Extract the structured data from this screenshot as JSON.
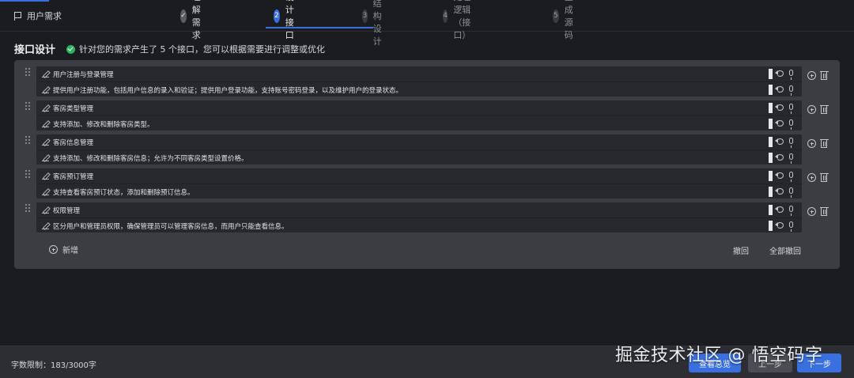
{
  "header": {
    "crumb_label": "用户需求"
  },
  "steps": [
    {
      "num": "✓",
      "label": "理解需求",
      "state": "done"
    },
    {
      "num": "2",
      "label": "设计接口",
      "state": "active"
    },
    {
      "num": "3",
      "label": "表结构设计",
      "state": "pending"
    },
    {
      "num": "4",
      "label": "处理逻辑（接口）",
      "state": "pending"
    },
    {
      "num": "5",
      "label": "生成源码",
      "state": "pending"
    }
  ],
  "section": {
    "title": "接口设计",
    "notice": "针对您的需求产生了 5 个接口，您可以根据需要进行调整或优化"
  },
  "interfaces": [
    {
      "name": "用户注册与登录管理",
      "description": "提供用户注册功能，包括用户信息的录入和验证；提供用户登录功能，支持账号密码登录，以及维护用户的登录状态。"
    },
    {
      "name": "客房类型管理",
      "description": "支持添加、修改和删除客房类型。"
    },
    {
      "name": "客房信息管理",
      "description": "支持添加、修改和删除客房信息；允许为不同客房类型设置价格。"
    },
    {
      "name": "客房预订管理",
      "description": "支持查看客房预订状态，添加和删除预订信息。"
    },
    {
      "name": "权限管理",
      "description": "区分用户和管理员权限，确保管理员可以管理客房信息，而用户只能查看信息。"
    }
  ],
  "actions": {
    "add_label": "新增",
    "undo_label": "撤回",
    "undo_all_label": "全部撤回"
  },
  "footer": {
    "word_count": "字数限制：183/3000字",
    "btn_overview": "查看总览",
    "btn_prev": "上一步",
    "btn_next": "下一步"
  },
  "watermark": "掘金技术社区 @ 悟空码字",
  "colors": {
    "accent": "#3a6fe0",
    "success": "#2db55d",
    "background": "#1b1c20",
    "panel": "#3b3d43"
  }
}
